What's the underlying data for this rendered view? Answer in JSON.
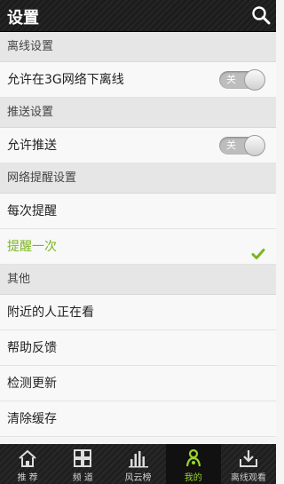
{
  "header": {
    "title": "设置"
  },
  "sections": [
    {
      "label": "离线设置"
    },
    {
      "label": "推送设置"
    },
    {
      "label": "网络提醒设置"
    },
    {
      "label": "其他"
    }
  ],
  "rows": {
    "offline_3g": {
      "label": "允许在3G网络下离线",
      "toggle_label": "关",
      "toggle_on": false
    },
    "push": {
      "label": "允许推送",
      "toggle_label": "关",
      "toggle_on": false
    },
    "remind_every": {
      "label": "每次提醒"
    },
    "remind_once": {
      "label": "提醒一次",
      "selected": true
    },
    "nearby": {
      "label": "附近的人正在看"
    },
    "feedback": {
      "label": "帮助反馈"
    },
    "update": {
      "label": "检测更新"
    },
    "clear_cache": {
      "label": "清除缓存"
    }
  },
  "tabs": [
    {
      "label": "推 荐",
      "icon": "home-icon"
    },
    {
      "label": "频 道",
      "icon": "grid-icon"
    },
    {
      "label": "风云榜",
      "icon": "bar-chart-icon"
    },
    {
      "label": "我的",
      "icon": "user-icon",
      "active": true
    },
    {
      "label": "离线观看",
      "icon": "download-icon"
    }
  ],
  "colors": {
    "accent": "#7bb51f",
    "bar": "#1c1c1c"
  }
}
